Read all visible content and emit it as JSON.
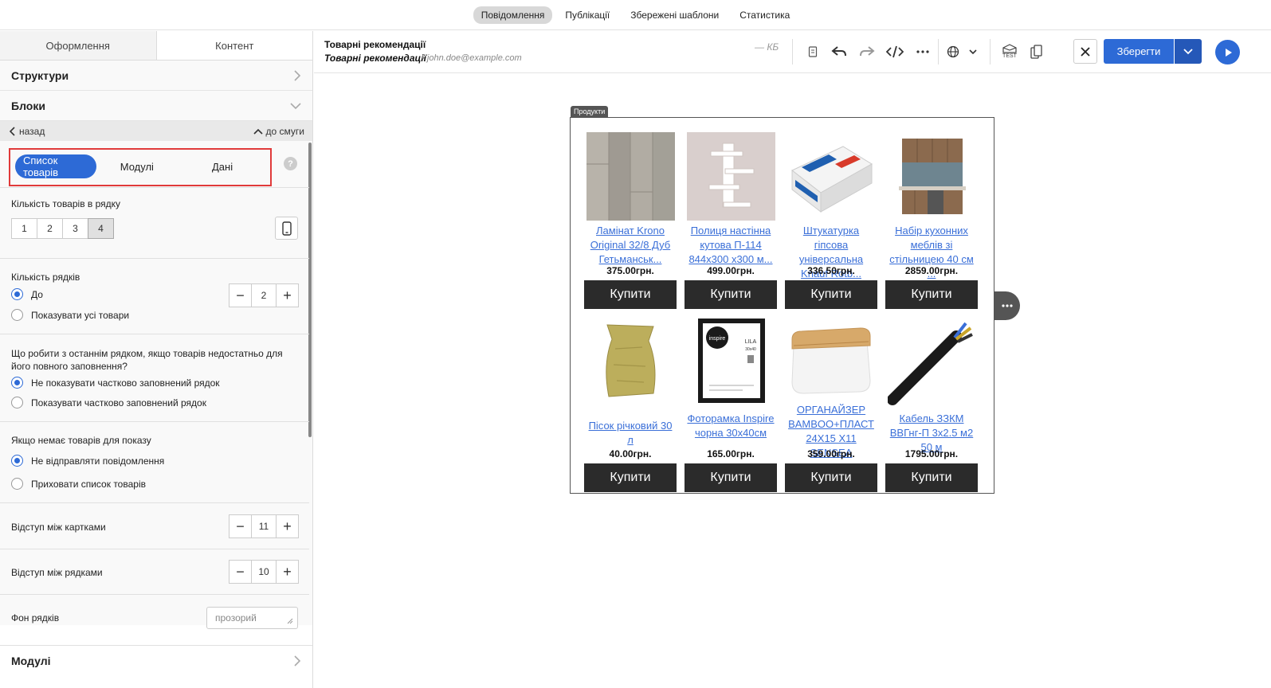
{
  "top_nav": {
    "tabs": [
      {
        "label": "Повідомлення",
        "active": true
      },
      {
        "label": "Публікації",
        "active": false
      },
      {
        "label": "Збережені шаблони",
        "active": false
      },
      {
        "label": "Статистика",
        "active": false
      }
    ]
  },
  "left_panel": {
    "tabs": [
      "Оформлення",
      "Контент"
    ],
    "active_tab": "Контент",
    "structures_title": "Структури",
    "blocks_title": "Блоки",
    "back_label": "назад",
    "to_stripe_label": "до смуги",
    "segment": {
      "options": [
        "Список товарів",
        "Модулі",
        "Дані"
      ],
      "selected": "Список товарів"
    },
    "help_glyph": "?",
    "per_row": {
      "label": "Кількість товарів в рядку",
      "options": [
        "1",
        "2",
        "3",
        "4"
      ],
      "selected": "4"
    },
    "rows": {
      "label": "Кількість рядків",
      "option_up_to": "До",
      "option_all": "Показувати усі товари",
      "value": "2"
    },
    "last_row": {
      "label": "Що робити з останнім рядком, якщо товарів недостатньо для його повного заповнення?",
      "option_hide": "Не показувати частково заповнений рядок",
      "option_show": "Показувати частково заповнений рядок"
    },
    "no_products": {
      "label": "Якщо немає товарів для показу",
      "option_dont_send": "Не відправляти повідомлення",
      "option_hide": "Приховати список товарів"
    },
    "card_gap": {
      "label": "Відступ між картками",
      "value": "11"
    },
    "row_gap": {
      "label": "Відступ між рядками",
      "value": "10"
    },
    "row_bg": {
      "label": "Фон рядків",
      "value": "прозорий"
    },
    "modules_title": "Модулі",
    "minus": "−",
    "plus": "+"
  },
  "header": {
    "title": "Товарні рекомендації",
    "subtitle": "Товарні рекомендації",
    "sender": "• john.doe@example.com",
    "size": "— КБ",
    "save_label": "Зберегти",
    "test_label": "TEST"
  },
  "canvas": {
    "block_tag": "Продукти",
    "buy_label": "Купити",
    "products": [
      {
        "name": "Ламінат Krono Original 32/8 Дуб Гетьманськ...",
        "price": "375.00грн.",
        "image": "laminate"
      },
      {
        "name": "Полиця настінна кутова П-114 844x300 x300 м...",
        "price": "499.00грн.",
        "image": "shelf"
      },
      {
        "name": "Штукатурка гіпсова універсальна Knauf Rotb...",
        "price": "336.50грн.",
        "image": "plaster-bag"
      },
      {
        "name": "Набір кухонних меблів зі стільницею 40 см ...",
        "price": "2859.00грн.",
        "image": "kitchen"
      },
      {
        "name": "Пісок річковий 30 л",
        "price": "40.00грн.",
        "image": "sand-bag"
      },
      {
        "name": "Фоторамка Inspire чорна 30x40см",
        "price": "165.00грн.",
        "image": "photo-frame"
      },
      {
        "name": "ОРГАНАЙЗЕР BAMBOO+ПЛАСТ 24X15 X11 SENSEA",
        "price": "359.00грн.",
        "image": "organizer"
      },
      {
        "name": "Кабель ЗЗКМ ВВГнг-П 3х2.5 м2 50 м",
        "price": "1795.00грн.",
        "image": "cable"
      }
    ],
    "frame_brand": "inspire",
    "frame_title": "LILA",
    "frame_size": "30x40"
  },
  "colors": {
    "accent": "#2d6ad6",
    "highlight": "#e03a3a",
    "buy_button": "#2b2b2b",
    "link": "#3a6fd8"
  }
}
